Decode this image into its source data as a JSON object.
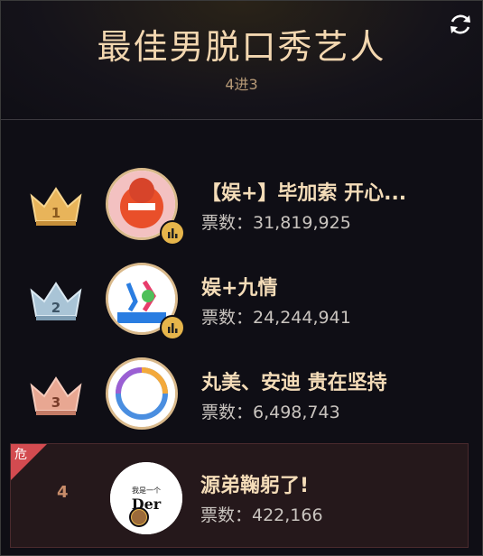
{
  "header": {
    "title": "最佳男脱口秀艺人",
    "subtitle": "4进3"
  },
  "entries": [
    {
      "rank": "1",
      "name": "【娱+】毕加索 开心...",
      "votes": "票数：31,819,925"
    },
    {
      "rank": "2",
      "name": "娱+九情",
      "votes": "票数：24,244,941"
    },
    {
      "rank": "3",
      "name": "丸美、安迪 贵在坚持",
      "votes": "票数：6,498,743"
    },
    {
      "rank": "4",
      "name": "源弟鞠躬了!",
      "votes": "票数：422,166",
      "danger_label": "危",
      "avatar_text_top": "我是一个",
      "avatar_text_main": "Der"
    }
  ],
  "colors": {
    "gold": "#f3d7b0",
    "danger": "#d34b50"
  }
}
